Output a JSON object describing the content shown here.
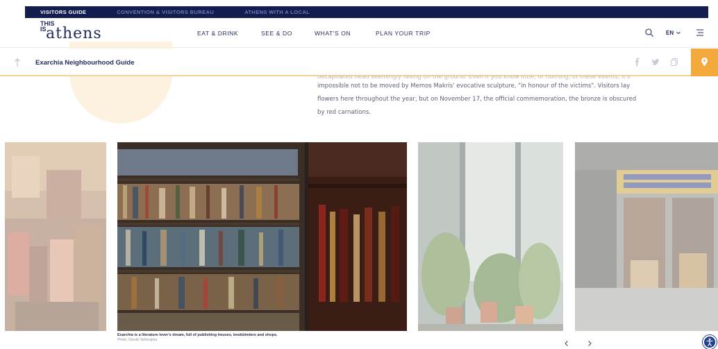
{
  "topbar": {
    "links": [
      "VISITORS GUIDE",
      "CONVENTION & VISITORS BUREAU",
      "ATHENS WITH A LOCAL"
    ]
  },
  "header": {
    "logo_small": "THIS IS",
    "logo_big": "athens",
    "nav": [
      "EAT & DRINK",
      "SEE & DO",
      "WHAT'S ON",
      "PLAN YOUR TRIP"
    ],
    "lang": "EN"
  },
  "article_bar": {
    "title": "Exarchia Neighbourhood Guide"
  },
  "body": {
    "faded_line": "decapitated head seemingly falling on the ground. Even if you know little, or nothing, of these events, it's",
    "line1": "impossible not to be moved by Memos Makris' evocative sculpture, \"in honour of the victims\". Visitors lay",
    "line2": "flowers here throughout the year, but on November 17, the official commemoration, the bronze is obscured",
    "line3": "by red carnations."
  },
  "gallery": {
    "caption": "Exarchia is a literature lover's dream, full of publishing houses, bookbinders and shops.",
    "credit": "Photo: Orestis Seferoglou"
  },
  "colors": {
    "navy": "#141d4f",
    "accent": "#f4a93c",
    "text": "#1f2a5c"
  }
}
